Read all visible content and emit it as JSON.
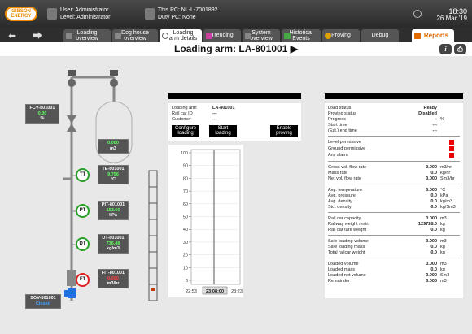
{
  "header": {
    "logo_line1": "GIBSON",
    "logo_line2": "ENERGY",
    "user": "User: Administrator",
    "level": "Level: Administrator",
    "pc": "This PC: NL-L-7001892",
    "duty": "Duty PC: None",
    "time": "18:30",
    "date": "26 Mar '19"
  },
  "tabs": [
    {
      "l1": "Loading",
      "l2": "overview"
    },
    {
      "l1": "Dog house",
      "l2": "overview"
    },
    {
      "l1": "Loading",
      "l2": "arm details"
    },
    {
      "l1": "Trending",
      "l2": ""
    },
    {
      "l1": "System",
      "l2": "overview"
    },
    {
      "l1": "Historical",
      "l2": "Events"
    },
    {
      "l1": "Proving",
      "l2": ""
    },
    {
      "l1": "Debug",
      "l2": ""
    },
    {
      "l1": "Reports",
      "l2": ""
    }
  ],
  "title": "Loading arm: LA-801001 ▶",
  "title_buttons": {
    "info": "i",
    "print": "⎙"
  },
  "pid": {
    "fcv": {
      "tag": "FCV-801001",
      "value": "0.00",
      "unit": "%"
    },
    "level": {
      "value": "0.000",
      "unit": "m3"
    },
    "te": {
      "tag": "TE-801001",
      "value": "9.756",
      "unit": "°C",
      "symbol": "TT"
    },
    "pit": {
      "tag": "PIT-801001",
      "value": "153.60",
      "unit": "kPa",
      "symbol": "PT"
    },
    "dt": {
      "tag": "DT-801001",
      "value": "736.48",
      "unit": "kg/m3",
      "symbol": "DT"
    },
    "fit": {
      "tag": "FIT-801001",
      "value": "0.000",
      "unit": "m3/hr",
      "symbol": "FT"
    },
    "sov": {
      "tag": "SOV-801001",
      "state": "Closed"
    }
  },
  "info": {
    "rows": [
      {
        "k": "Loading arm",
        "v": "LA-801001"
      },
      {
        "k": "Rail car ID",
        "v": "---"
      },
      {
        "k": "Customer",
        "v": "---"
      }
    ],
    "buttons": {
      "configure_l1": "Configure",
      "configure_l2": "loading",
      "start_l1": "Start",
      "start_l2": "loading",
      "enable_l1": "Enable",
      "enable_l2": "proving"
    }
  },
  "trend": {
    "y_ticks": [
      "100",
      "90",
      "80",
      "70",
      "60",
      "50",
      "40",
      "30",
      "20",
      "10",
      "0"
    ],
    "x_labels": [
      "22:53",
      "23:08:00",
      "23:23"
    ]
  },
  "status": {
    "groups": [
      [
        {
          "k": "Load status",
          "v": "Ready",
          "u": ""
        },
        {
          "k": "Proving status",
          "v": "Disabled",
          "u": ""
        },
        {
          "k": "Progress",
          "v": "-",
          "u": "%"
        },
        {
          "k": "Start time",
          "v": "---",
          "u": ""
        },
        {
          "k": "(Est.) end time",
          "v": "---",
          "u": ""
        }
      ],
      [
        {
          "k": "Level permissive",
          "v": "",
          "u": "",
          "alarm": true
        },
        {
          "k": "Ground permissive",
          "v": "",
          "u": "",
          "alarm": true
        },
        {
          "k": "Any alarm",
          "v": "",
          "u": "",
          "alarm": true
        }
      ],
      [
        {
          "k": "Gross vol. flow rate",
          "v": "0.000",
          "u": "m3/hr"
        },
        {
          "k": "Mass rate",
          "v": "0.0",
          "u": "kg/hr"
        },
        {
          "k": "Net vol. flow rate",
          "v": "0.000",
          "u": "Sm3/hr"
        }
      ],
      [
        {
          "k": "Avg. temperature",
          "v": "0.000",
          "u": "°C"
        },
        {
          "k": "Avg. pressure",
          "v": "0.0",
          "u": "kPa"
        },
        {
          "k": "Avg. density",
          "v": "0.0",
          "u": "kg/m3"
        },
        {
          "k": "Std. density",
          "v": "0.0",
          "u": "kg/Sm3"
        }
      ],
      [
        {
          "k": "Rail car capacity",
          "v": "0.000",
          "u": "m3"
        },
        {
          "k": "Railway weight restr.",
          "v": "129728.0",
          "u": "kg"
        },
        {
          "k": "Rail car tare weight",
          "v": "0.0",
          "u": "kg"
        }
      ],
      [
        {
          "k": "Safe loading volume",
          "v": "0.000",
          "u": "m3"
        },
        {
          "k": "Safe loading mass",
          "v": "0.0",
          "u": "kg"
        },
        {
          "k": "Total railcar weight",
          "v": "0.0",
          "u": "kg"
        }
      ],
      [
        {
          "k": "Loaded volume",
          "v": "0.000",
          "u": "m3"
        },
        {
          "k": "Loaded mass",
          "v": "0.0",
          "u": "kg"
        },
        {
          "k": "Loaded net volume",
          "v": "0.000",
          "u": "Sm3"
        },
        {
          "k": "Remainder",
          "v": "0.000",
          "u": "m3"
        }
      ]
    ]
  },
  "colors": {
    "accent": "#e06a00",
    "alarm": "#e00000",
    "ok": "#2aa02a",
    "live_value": "#5cff5c"
  }
}
